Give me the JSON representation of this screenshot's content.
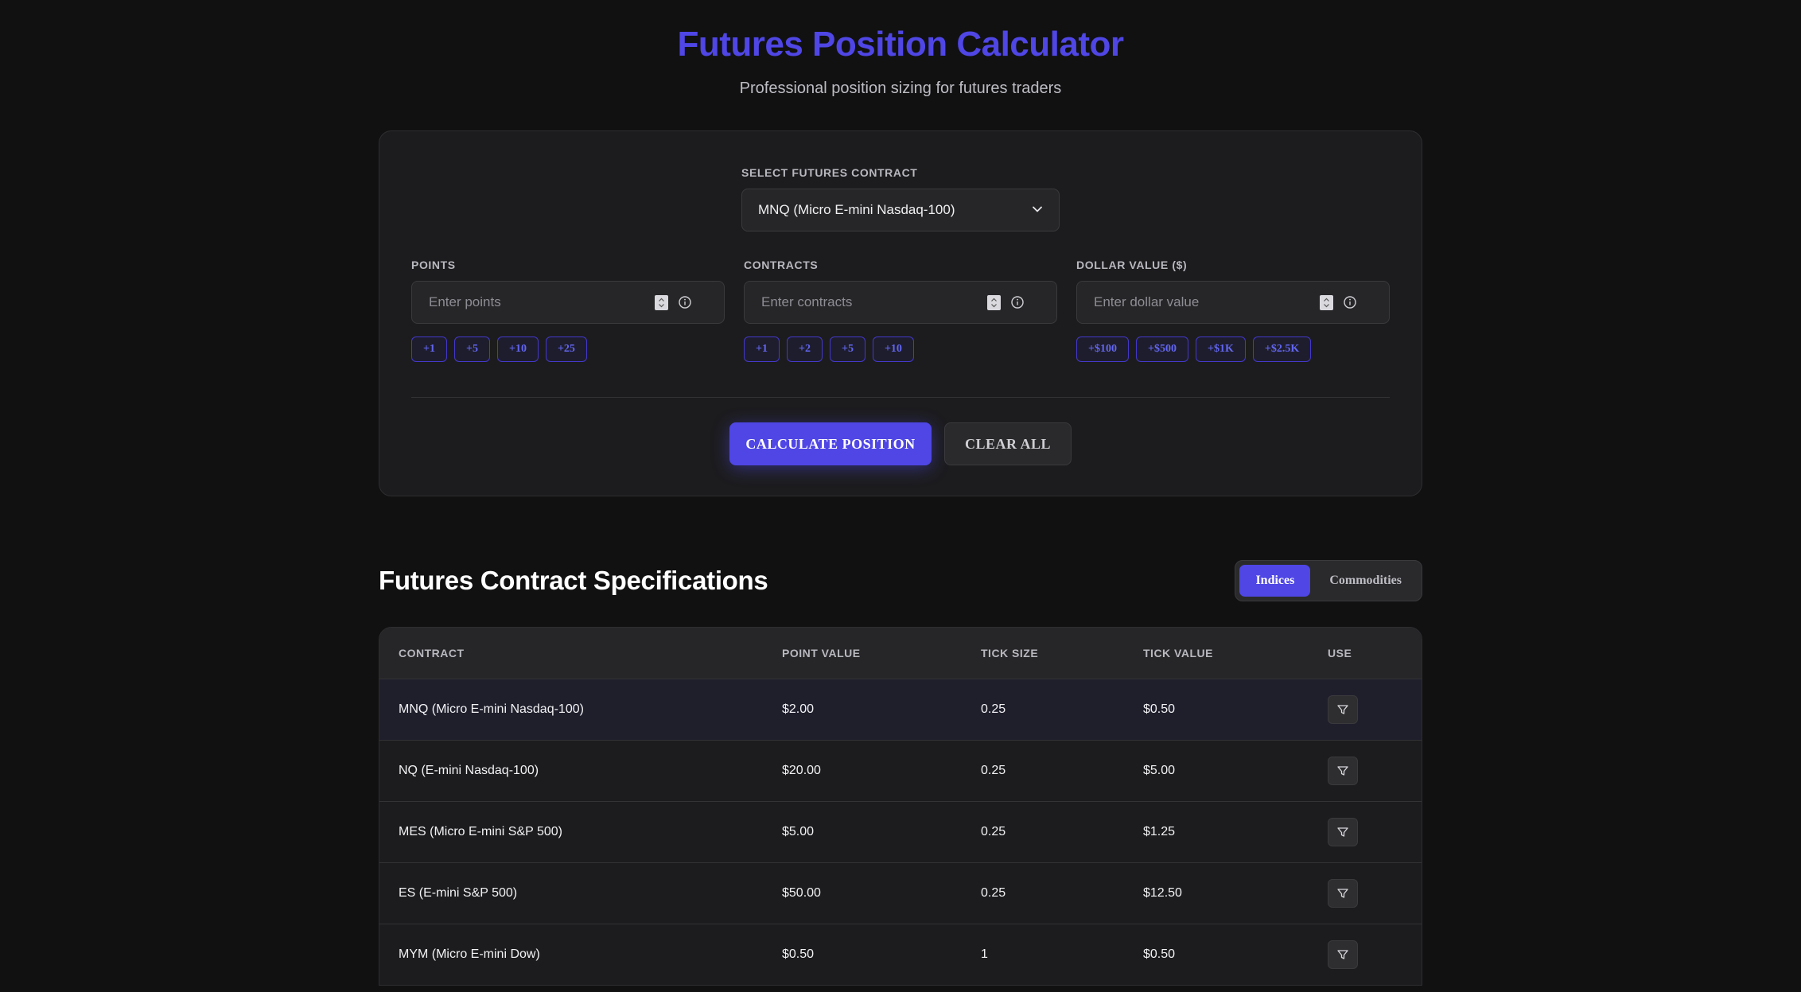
{
  "header": {
    "title": "Futures Position Calculator",
    "subtitle": "Professional position sizing for futures traders"
  },
  "calculator": {
    "contract_label": "SELECT FUTURES CONTRACT",
    "contract_selected": "MNQ (Micro E-mini Nasdaq-100)",
    "fields": [
      {
        "label": "POINTS",
        "placeholder": "Enter points",
        "chips": [
          "+1",
          "+5",
          "+10",
          "+25"
        ]
      },
      {
        "label": "CONTRACTS",
        "placeholder": "Enter contracts",
        "chips": [
          "+1",
          "+2",
          "+5",
          "+10"
        ]
      },
      {
        "label": "DOLLAR VALUE ($)",
        "placeholder": "Enter dollar value",
        "chips": [
          "+$100",
          "+$500",
          "+$1K",
          "+$2.5K"
        ]
      }
    ],
    "calculate_label": "CALCULATE POSITION",
    "clear_label": "CLEAR ALL"
  },
  "specs": {
    "title": "Futures Contract Specifications",
    "tabs": [
      "Indices",
      "Commodities"
    ],
    "active_tab": "Indices",
    "columns": [
      "CONTRACT",
      "POINT VALUE",
      "TICK SIZE",
      "TICK VALUE",
      "USE"
    ],
    "rows": [
      {
        "contract": "MNQ (Micro E-mini Nasdaq-100)",
        "point_value": "$2.00",
        "tick_size": "0.25",
        "tick_value": "$0.50"
      },
      {
        "contract": "NQ (E-mini Nasdaq-100)",
        "point_value": "$20.00",
        "tick_size": "0.25",
        "tick_value": "$5.00"
      },
      {
        "contract": "MES (Micro E-mini S&P 500)",
        "point_value": "$5.00",
        "tick_size": "0.25",
        "tick_value": "$1.25"
      },
      {
        "contract": "ES (E-mini S&P 500)",
        "point_value": "$50.00",
        "tick_size": "0.25",
        "tick_value": "$12.50"
      },
      {
        "contract": "MYM (Micro E-mini Dow)",
        "point_value": "$0.50",
        "tick_size": "1",
        "tick_value": "$0.50"
      }
    ]
  },
  "colors": {
    "accent": "#4f46e5",
    "background": "#111112",
    "card": "#1c1c1e"
  },
  "icons": {
    "select": "chevron-down-icon",
    "field_info": "info-icon",
    "use": "filter-icon"
  }
}
